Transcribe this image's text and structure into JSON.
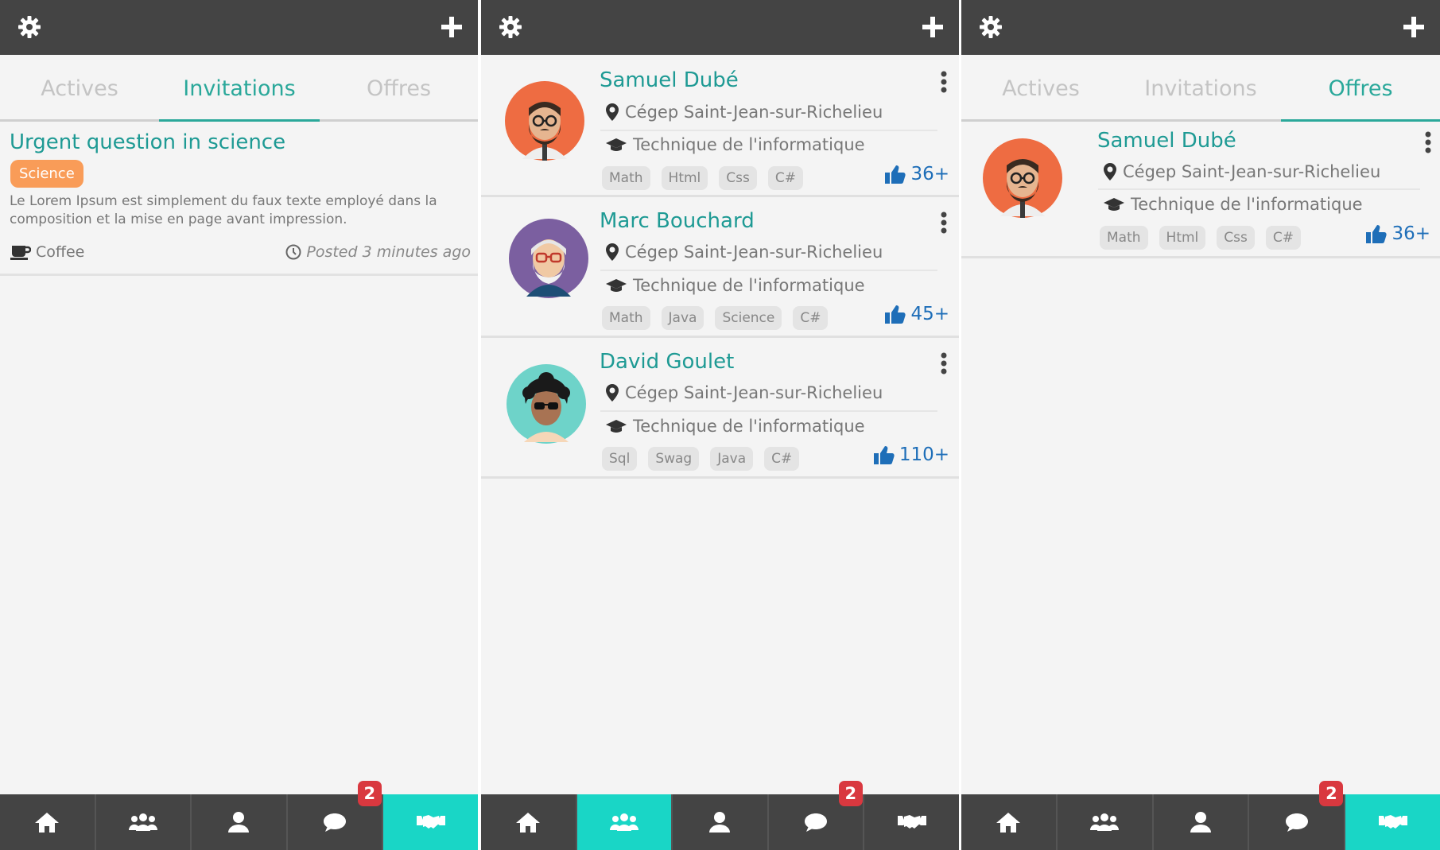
{
  "colors": {
    "accent": "#2aa89a",
    "topbar": "#444444",
    "active_nav": "#19d6c6",
    "tag_orange": "#f99c58",
    "badge": "#d9383f",
    "like_blue": "#1e6eb8"
  },
  "icons": {
    "top_left": "gear-icon",
    "top_right": "plus-icon",
    "nav": [
      "home-icon",
      "group-icon",
      "user-icon",
      "chat-bubble-icon",
      "handshake-icon"
    ]
  },
  "tabs": [
    "Actives",
    "Invitations",
    "Offres"
  ],
  "invitation": {
    "title": "Urgent question in science",
    "tag": "Science",
    "description": "Le Lorem Ipsum est simplement du faux texte employé dans la composition et la mise en page avant impression.",
    "category": "Coffee",
    "posted": "Posted 3 minutes ago"
  },
  "people": [
    {
      "name": "Samuel Dubé",
      "school": "Cégep Saint-Jean-sur-Richelieu",
      "program": "Technique de l'informatique",
      "tags": [
        "Math",
        "Html",
        "Css",
        "C#"
      ],
      "likes": "36+"
    },
    {
      "name": "Marc Bouchard",
      "school": "Cégep Saint-Jean-sur-Richelieu",
      "program": "Technique de l'informatique",
      "tags": [
        "Math",
        "Java",
        "Science",
        "C#"
      ],
      "likes": "45+"
    },
    {
      "name": "David Goulet",
      "school": "Cégep Saint-Jean-sur-Richelieu",
      "program": "Technique de l'informatique",
      "tags": [
        "Sql",
        "Swag",
        "Java",
        "C#"
      ],
      "likes": "110+"
    }
  ],
  "offer": {
    "name": "Samuel Dubé",
    "school": "Cégep Saint-Jean-sur-Richelieu",
    "program": "Technique de l'informatique",
    "tags": [
      "Math",
      "Html",
      "Css",
      "C#"
    ],
    "likes": "36+"
  },
  "nav_badge": "2"
}
